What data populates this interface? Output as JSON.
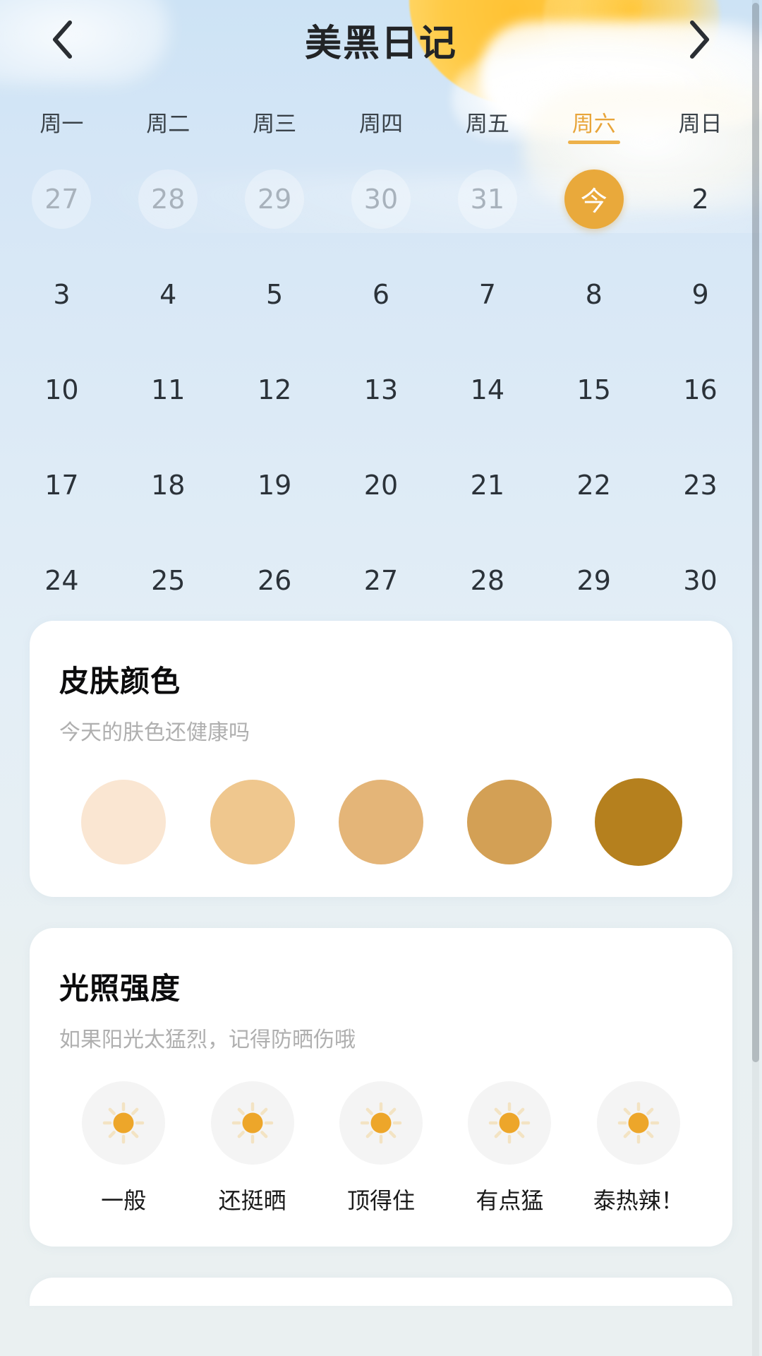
{
  "header": {
    "title": "美黑日记",
    "back_icon": "chevron-left-icon",
    "forward_icon": "chevron-right-icon"
  },
  "calendar": {
    "weekdays": [
      {
        "label": "周一",
        "active": false
      },
      {
        "label": "周二",
        "active": false
      },
      {
        "label": "周三",
        "active": false
      },
      {
        "label": "周四",
        "active": false
      },
      {
        "label": "周五",
        "active": false
      },
      {
        "label": "周六",
        "active": true
      },
      {
        "label": "周日",
        "active": false
      }
    ],
    "rows": [
      [
        {
          "label": "27",
          "state": "muted"
        },
        {
          "label": "28",
          "state": "muted"
        },
        {
          "label": "29",
          "state": "muted"
        },
        {
          "label": "30",
          "state": "muted"
        },
        {
          "label": "31",
          "state": "muted"
        },
        {
          "label": "今",
          "state": "today"
        },
        {
          "label": "2",
          "state": "normal"
        }
      ],
      [
        {
          "label": "3",
          "state": "normal"
        },
        {
          "label": "4",
          "state": "normal"
        },
        {
          "label": "5",
          "state": "normal"
        },
        {
          "label": "6",
          "state": "normal"
        },
        {
          "label": "7",
          "state": "normal"
        },
        {
          "label": "8",
          "state": "normal"
        },
        {
          "label": "9",
          "state": "normal"
        }
      ],
      [
        {
          "label": "10",
          "state": "normal"
        },
        {
          "label": "11",
          "state": "normal"
        },
        {
          "label": "12",
          "state": "normal"
        },
        {
          "label": "13",
          "state": "normal"
        },
        {
          "label": "14",
          "state": "normal"
        },
        {
          "label": "15",
          "state": "normal"
        },
        {
          "label": "16",
          "state": "normal"
        }
      ],
      [
        {
          "label": "17",
          "state": "normal"
        },
        {
          "label": "18",
          "state": "normal"
        },
        {
          "label": "19",
          "state": "normal"
        },
        {
          "label": "20",
          "state": "normal"
        },
        {
          "label": "21",
          "state": "normal"
        },
        {
          "label": "22",
          "state": "normal"
        },
        {
          "label": "23",
          "state": "normal"
        }
      ],
      [
        {
          "label": "24",
          "state": "normal"
        },
        {
          "label": "25",
          "state": "normal"
        },
        {
          "label": "26",
          "state": "normal"
        },
        {
          "label": "27",
          "state": "normal"
        },
        {
          "label": "28",
          "state": "normal"
        },
        {
          "label": "29",
          "state": "normal"
        },
        {
          "label": "30",
          "state": "normal"
        }
      ]
    ],
    "today_accent_color": "#E9A93B"
  },
  "skin_color_card": {
    "title": "皮肤颜色",
    "subtitle": "今天的肤色还健康吗",
    "swatches": [
      {
        "color": "#FAE6D2",
        "name": "swatch-1"
      },
      {
        "color": "#EFC78E",
        "name": "swatch-2"
      },
      {
        "color": "#E4B578",
        "name": "swatch-3"
      },
      {
        "color": "#D3A055",
        "name": "swatch-4"
      },
      {
        "color": "#B5801E",
        "name": "swatch-5"
      }
    ]
  },
  "light_intensity_card": {
    "title": "光照强度",
    "subtitle": "如果阳光太猛烈，记得防晒伤哦",
    "icon_name": "sun-icon",
    "sun_color": "#EDA62A",
    "ray_color": "#F3E3C3",
    "levels": [
      {
        "label": "一般"
      },
      {
        "label": "还挺晒"
      },
      {
        "label": "顶得住"
      },
      {
        "label": "有点猛"
      },
      {
        "label": "泰热辣！"
      }
    ]
  }
}
